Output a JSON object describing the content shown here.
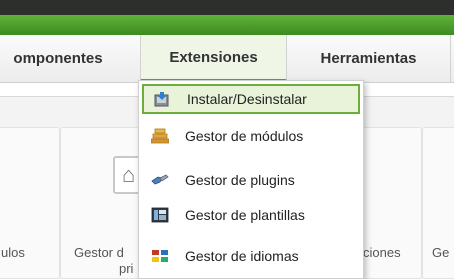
{
  "menubar": {
    "items": [
      {
        "label": "omponentes"
      },
      {
        "label": "Extensiones"
      },
      {
        "label": "Herramientas"
      }
    ]
  },
  "dropdown": {
    "items": [
      {
        "label": "Instalar/Desinstalar",
        "icon": "install-box-icon",
        "highlighted": true
      },
      {
        "label": "Gestor de módulos",
        "icon": "modules-icon"
      },
      {
        "label": "Gestor de plugins",
        "icon": "plugin-icon"
      },
      {
        "label": "Gestor de plantillas",
        "icon": "templates-icon"
      },
      {
        "label": "Gestor de idiomas",
        "icon": "languages-icon"
      }
    ]
  },
  "cpanel": {
    "tiles": [
      {
        "label": "ulos"
      },
      {
        "label": "Gestor d",
        "label2": "pri"
      },
      {
        "label": "ciones"
      },
      {
        "label": "Ge"
      }
    ]
  },
  "colors": {
    "accent_green": "#5aa633",
    "topbar": "#2c2f2c",
    "highlight_bg": "#e9f3da"
  }
}
